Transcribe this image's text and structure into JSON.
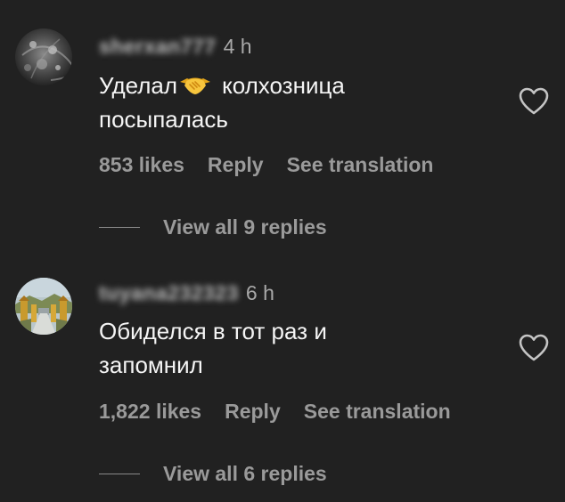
{
  "comments": [
    {
      "username": "sherxan777",
      "time": "4 h",
      "text_lines": [
        "Уделал",
        "колхозница",
        "посыпалась"
      ],
      "emoji": "handshake-emoji",
      "likes": "853 likes",
      "reply_label": "Reply",
      "translate_label": "See translation",
      "view_replies": "View all 9 replies",
      "avatar": "dark-glitter-avatar"
    },
    {
      "username": "tuyana232323",
      "time": "6 h",
      "text_lines": [
        "Обиделся в тот раз и",
        "запомнил"
      ],
      "likes": "1,822 likes",
      "reply_label": "Reply",
      "translate_label": "See translation",
      "view_replies": "View all 6 replies",
      "avatar": "golden-temple-avatar"
    }
  ],
  "icons": {
    "like": "heart-outline-icon"
  },
  "colors": {
    "background": "#212121",
    "text_primary": "#f5f5f5",
    "text_secondary": "#9a9a9a"
  }
}
